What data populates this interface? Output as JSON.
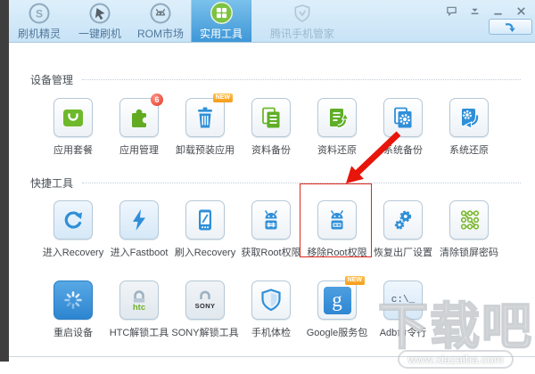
{
  "tabs": [
    {
      "label": "刷机精灵",
      "icon": "shuame-logo-icon",
      "icon_letter": "S",
      "selected": false
    },
    {
      "label": "一键刷机",
      "icon": "one-key-flash-cursor-icon",
      "selected": false
    },
    {
      "label": "ROM市场",
      "icon": "android-robot-icon",
      "selected": false
    },
    {
      "label": "实用工具",
      "icon": "green-grid-toolbox-icon",
      "selected": true
    },
    {
      "label": "腾讯手机管家",
      "icon": "gray-shield-icon",
      "selected": false,
      "disabled": true
    }
  ],
  "window_controls": {
    "feedback_icon": "speech-bubble",
    "menu_icon": "main-menu-chevron",
    "minimize_icon": "minimize",
    "close_icon": "close",
    "skip_button_icon": "curved-blue-arrow"
  },
  "sections": [
    {
      "title": "设备管理",
      "rows": [
        [
          {
            "label": "应用套餐",
            "icon": "green-shopping-bag"
          },
          {
            "label": "应用管理",
            "icon": "green-puzzle-piece",
            "badge": "6"
          },
          {
            "label": "卸载预装应用",
            "icon": "blue-trash-can",
            "badge": "NEW"
          },
          {
            "label": "资料备份",
            "icon": "green-documents"
          },
          {
            "label": "资料还原",
            "icon": "green-document-restore-arrow"
          },
          {
            "label": "系统备份",
            "icon": "blue-document-gear"
          },
          {
            "label": "系统还原",
            "icon": "blue-gear-restore-arrow"
          }
        ]
      ]
    },
    {
      "title": "快捷工具",
      "rows": [
        [
          {
            "label": "进入Recovery",
            "icon": "blue-circular-arrow"
          },
          {
            "label": "进入Fastboot",
            "icon": "blue-lightning-bolt"
          },
          {
            "label": "刷入Recovery",
            "icon": "blue-phone-flash"
          },
          {
            "label": "获取Root权限",
            "icon": "android-head-hash-tile"
          },
          {
            "label": "移除Root权限",
            "icon": "android-head-grill-tile",
            "highlighted": true
          },
          {
            "label": "恢复出厂设置",
            "icon": "blue-gears"
          },
          {
            "label": "清除锁屏密码",
            "icon": "green-pattern-lock"
          }
        ],
        [
          {
            "label": "重启设备",
            "icon": "white-spinner-on-blue"
          },
          {
            "label": "HTC解锁工具",
            "icon": "padlock",
            "icon_text": "htc"
          },
          {
            "label": "SONY解锁工具",
            "icon": "padlock",
            "icon_text": "SONY"
          },
          {
            "label": "手机体检",
            "icon": "blue-shield"
          },
          {
            "label": "Google服务包",
            "icon": "blue-square-g",
            "icon_text": "g",
            "badge": "NEW"
          },
          {
            "label": "Adb命令行",
            "icon": "command-prompt",
            "icon_text": "c:\\_"
          }
        ]
      ]
    }
  ],
  "annotation": {
    "type": "red-box-and-arrow",
    "highlighted_item": "移除Root权限"
  },
  "watermark": {
    "title": "下载吧",
    "url": "www.xiazaiba.com"
  },
  "colors": {
    "accent_blue": "#2f8fd8",
    "accent_green": "#6eb92b",
    "selected_tab_blue": "#3e97d7",
    "annotation_red": "#e8150b",
    "badge_red": "#e23527",
    "badge_orange": "#f59c1a"
  }
}
